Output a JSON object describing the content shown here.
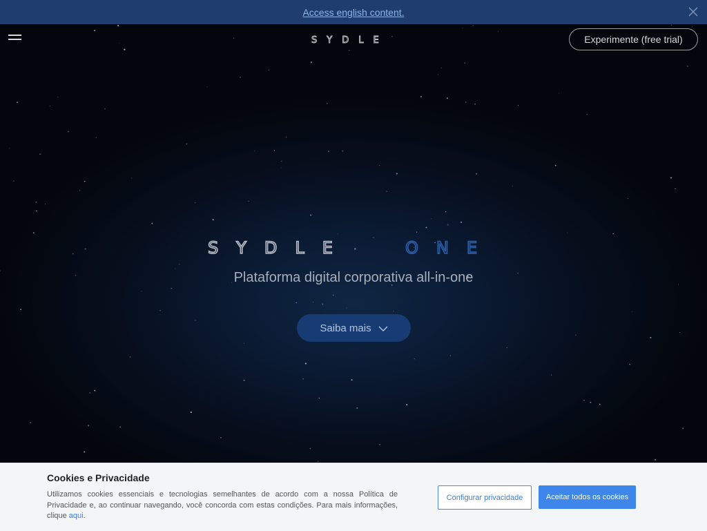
{
  "banner": {
    "link_text": "Access english content."
  },
  "header": {
    "logo_text": "SYDLE",
    "trial_label": "Experimente (free trial)"
  },
  "hero": {
    "logo_word": "SYDLE",
    "logo_product": "ONE",
    "tagline": "Plataforma digital corporativa all-in-one",
    "cta_label": "Saiba mais"
  },
  "cookies": {
    "title": "Cookies e Privacidade",
    "text": "Utilizamos cookies essenciais e tecnologias semelhantes de acordo com a nossa Política de Privacidade e, ao continuar navegando, você concorda com estas condições. Para mais informações, clique ",
    "link_text": "aqui",
    "text_end": ".",
    "config_label": "Configurar privacidade",
    "accept_label": "Aceitar todos os cookies"
  },
  "colors": {
    "banner_bg": "#1f3d6e",
    "accent_blue": "#3e86ea",
    "logo_one_blue": "#2c5aa0"
  },
  "icons": [
    "close-icon",
    "menu-icon",
    "chevron-down-icon"
  ]
}
